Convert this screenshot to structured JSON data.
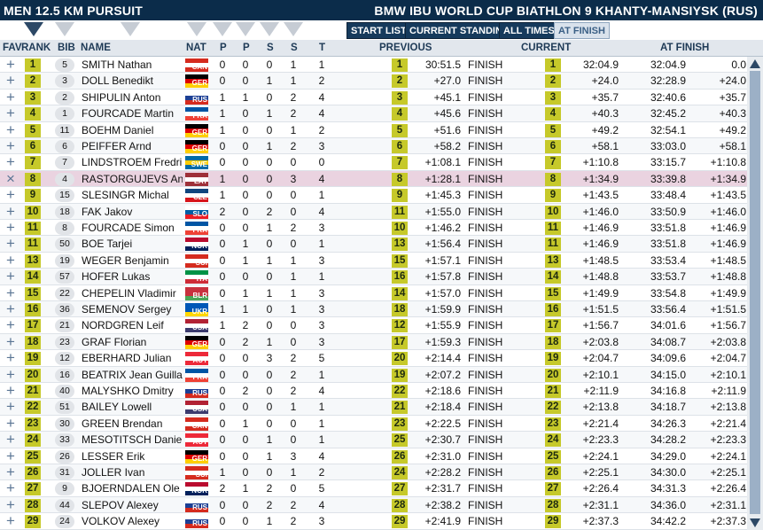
{
  "title_left": "MEN 12.5 KM PURSUIT",
  "title_right": "BMW IBU WORLD CUP BIATHLON 9 KHANTY-MANSIYSK (RUS)",
  "buttons": [
    "START LIST",
    "CURRENT STANDING",
    "ALL TIMES",
    "AT FINISH"
  ],
  "headers": {
    "fav": "FAV",
    "rank": "RANK",
    "bib": "BIB",
    "name": "NAME",
    "nat": "NAT",
    "p1": "P",
    "p2": "P",
    "s1": "S",
    "s2": "S",
    "t": "T",
    "previous": "PREVIOUS",
    "current": "CURRENT",
    "at_finish": "AT FINISH"
  },
  "flag_colors": {
    "CAN": [
      "#d52b1e",
      "#ffffff",
      "#d52b1e"
    ],
    "GER": [
      "#000000",
      "#dd0000",
      "#ffce00"
    ],
    "RUS": [
      "#ffffff",
      "#1c3f94",
      "#d52b1e"
    ],
    "FRA": [
      "#0055a4",
      "#ffffff",
      "#ef4135"
    ],
    "SWE": [
      "#006aa7",
      "#fecc00",
      "#006aa7"
    ],
    "LAT": [
      "#9e3039",
      "#ffffff",
      "#9e3039"
    ],
    "CZE": [
      "#11457e",
      "#ffffff",
      "#d7141a"
    ],
    "SLO": [
      "#ffffff",
      "#005da4",
      "#ed1c24"
    ],
    "NOR": [
      "#ba0c2f",
      "#ffffff",
      "#00205b"
    ],
    "SUI": [
      "#d52b1e",
      "#ffffff",
      "#d52b1e"
    ],
    "ITA": [
      "#009246",
      "#ffffff",
      "#ce2b37"
    ],
    "BLR": [
      "#c8313e",
      "#c8313e",
      "#4aa657"
    ],
    "UKR": [
      "#0057b7",
      "#0057b7",
      "#ffd700"
    ],
    "USA": [
      "#b22234",
      "#ffffff",
      "#3c3b6e"
    ],
    "AUT": [
      "#ed2939",
      "#ffffff",
      "#ed2939"
    ]
  },
  "rows": [
    {
      "rank": "1",
      "bib": "5",
      "name": "SMITH Nathan",
      "nat": "CAN",
      "p1": "0",
      "p2": "0",
      "s1": "0",
      "s2": "1",
      "t": "1",
      "prev_rank": "1",
      "prev_time": "30:51.5",
      "prev_status": "FINISH",
      "cur_rank": "1",
      "cur_diff": "32:04.9",
      "fin_time": "32:04.9",
      "fin_diff": "0.0",
      "fav": false
    },
    {
      "rank": "2",
      "bib": "3",
      "name": "DOLL Benedikt",
      "nat": "GER",
      "p1": "0",
      "p2": "0",
      "s1": "1",
      "s2": "1",
      "t": "2",
      "prev_rank": "2",
      "prev_time": "+27.0",
      "prev_status": "FINISH",
      "cur_rank": "2",
      "cur_diff": "+24.0",
      "fin_time": "32:28.9",
      "fin_diff": "+24.0",
      "fav": false
    },
    {
      "rank": "3",
      "bib": "2",
      "name": "SHIPULIN Anton",
      "nat": "RUS",
      "p1": "1",
      "p2": "1",
      "s1": "0",
      "s2": "2",
      "t": "4",
      "prev_rank": "3",
      "prev_time": "+45.1",
      "prev_status": "FINISH",
      "cur_rank": "3",
      "cur_diff": "+35.7",
      "fin_time": "32:40.6",
      "fin_diff": "+35.7",
      "fav": false
    },
    {
      "rank": "4",
      "bib": "1",
      "name": "FOURCADE Martin",
      "nat": "FRA",
      "p1": "1",
      "p2": "0",
      "s1": "1",
      "s2": "2",
      "t": "4",
      "prev_rank": "4",
      "prev_time": "+45.6",
      "prev_status": "FINISH",
      "cur_rank": "4",
      "cur_diff": "+40.3",
      "fin_time": "32:45.2",
      "fin_diff": "+40.3",
      "fav": false
    },
    {
      "rank": "5",
      "bib": "11",
      "name": "BOEHM Daniel",
      "nat": "GER",
      "p1": "1",
      "p2": "0",
      "s1": "0",
      "s2": "1",
      "t": "2",
      "prev_rank": "5",
      "prev_time": "+51.6",
      "prev_status": "FINISH",
      "cur_rank": "5",
      "cur_diff": "+49.2",
      "fin_time": "32:54.1",
      "fin_diff": "+49.2",
      "fav": false
    },
    {
      "rank": "6",
      "bib": "6",
      "name": "PEIFFER Arnd",
      "nat": "GER",
      "p1": "0",
      "p2": "0",
      "s1": "1",
      "s2": "2",
      "t": "3",
      "prev_rank": "6",
      "prev_time": "+58.2",
      "prev_status": "FINISH",
      "cur_rank": "6",
      "cur_diff": "+58.1",
      "fin_time": "33:03.0",
      "fin_diff": "+58.1",
      "fav": false
    },
    {
      "rank": "7",
      "bib": "7",
      "name": "LINDSTROEM Fredrik",
      "nat": "SWE",
      "p1": "0",
      "p2": "0",
      "s1": "0",
      "s2": "0",
      "t": "0",
      "prev_rank": "7",
      "prev_time": "+1:08.1",
      "prev_status": "FINISH",
      "cur_rank": "7",
      "cur_diff": "+1:10.8",
      "fin_time": "33:15.7",
      "fin_diff": "+1:10.8",
      "fav": false
    },
    {
      "rank": "8",
      "bib": "4",
      "name": "RASTORGUJEVS Andre",
      "nat": "LAT",
      "p1": "1",
      "p2": "0",
      "s1": "0",
      "s2": "3",
      "t": "4",
      "prev_rank": "8",
      "prev_time": "+1:28.1",
      "prev_status": "FINISH",
      "cur_rank": "8",
      "cur_diff": "+1:34.9",
      "fin_time": "33:39.8",
      "fin_diff": "+1:34.9",
      "fav": true
    },
    {
      "rank": "9",
      "bib": "15",
      "name": "SLESINGR Michal",
      "nat": "CZE",
      "p1": "1",
      "p2": "0",
      "s1": "0",
      "s2": "0",
      "t": "1",
      "prev_rank": "9",
      "prev_time": "+1:45.3",
      "prev_status": "FINISH",
      "cur_rank": "9",
      "cur_diff": "+1:43.5",
      "fin_time": "33:48.4",
      "fin_diff": "+1:43.5",
      "fav": false
    },
    {
      "rank": "10",
      "bib": "18",
      "name": "FAK Jakov",
      "nat": "SLO",
      "p1": "2",
      "p2": "0",
      "s1": "2",
      "s2": "0",
      "t": "4",
      "prev_rank": "11",
      "prev_time": "+1:55.0",
      "prev_status": "FINISH",
      "cur_rank": "10",
      "cur_diff": "+1:46.0",
      "fin_time": "33:50.9",
      "fin_diff": "+1:46.0",
      "fav": false
    },
    {
      "rank": "11",
      "bib": "8",
      "name": "FOURCADE Simon",
      "nat": "FRA",
      "p1": "0",
      "p2": "0",
      "s1": "1",
      "s2": "2",
      "t": "3",
      "prev_rank": "10",
      "prev_time": "+1:46.2",
      "prev_status": "FINISH",
      "cur_rank": "11",
      "cur_diff": "+1:46.9",
      "fin_time": "33:51.8",
      "fin_diff": "+1:46.9",
      "fav": false
    },
    {
      "rank": "11",
      "bib": "50",
      "name": "BOE Tarjei",
      "nat": "NOR",
      "p1": "0",
      "p2": "1",
      "s1": "0",
      "s2": "0",
      "t": "1",
      "prev_rank": "13",
      "prev_time": "+1:56.4",
      "prev_status": "FINISH",
      "cur_rank": "11",
      "cur_diff": "+1:46.9",
      "fin_time": "33:51.8",
      "fin_diff": "+1:46.9",
      "fav": false
    },
    {
      "rank": "13",
      "bib": "19",
      "name": "WEGER Benjamin",
      "nat": "SUI",
      "p1": "0",
      "p2": "1",
      "s1": "1",
      "s2": "1",
      "t": "3",
      "prev_rank": "15",
      "prev_time": "+1:57.1",
      "prev_status": "FINISH",
      "cur_rank": "13",
      "cur_diff": "+1:48.5",
      "fin_time": "33:53.4",
      "fin_diff": "+1:48.5",
      "fav": false
    },
    {
      "rank": "14",
      "bib": "57",
      "name": "HOFER Lukas",
      "nat": "ITA",
      "p1": "0",
      "p2": "0",
      "s1": "0",
      "s2": "1",
      "t": "1",
      "prev_rank": "16",
      "prev_time": "+1:57.8",
      "prev_status": "FINISH",
      "cur_rank": "14",
      "cur_diff": "+1:48.8",
      "fin_time": "33:53.7",
      "fin_diff": "+1:48.8",
      "fav": false
    },
    {
      "rank": "15",
      "bib": "22",
      "name": "CHEPELIN Vladimir",
      "nat": "BLR",
      "p1": "0",
      "p2": "1",
      "s1": "1",
      "s2": "1",
      "t": "3",
      "prev_rank": "14",
      "prev_time": "+1:57.0",
      "prev_status": "FINISH",
      "cur_rank": "15",
      "cur_diff": "+1:49.9",
      "fin_time": "33:54.8",
      "fin_diff": "+1:49.9",
      "fav": false
    },
    {
      "rank": "16",
      "bib": "36",
      "name": "SEMENOV Sergey",
      "nat": "UKR",
      "p1": "1",
      "p2": "1",
      "s1": "0",
      "s2": "1",
      "t": "3",
      "prev_rank": "18",
      "prev_time": "+1:59.9",
      "prev_status": "FINISH",
      "cur_rank": "16",
      "cur_diff": "+1:51.5",
      "fin_time": "33:56.4",
      "fin_diff": "+1:51.5",
      "fav": false
    },
    {
      "rank": "17",
      "bib": "21",
      "name": "NORDGREN Leif",
      "nat": "USA",
      "p1": "1",
      "p2": "2",
      "s1": "0",
      "s2": "0",
      "t": "3",
      "prev_rank": "12",
      "prev_time": "+1:55.9",
      "prev_status": "FINISH",
      "cur_rank": "17",
      "cur_diff": "+1:56.7",
      "fin_time": "34:01.6",
      "fin_diff": "+1:56.7",
      "fav": false
    },
    {
      "rank": "18",
      "bib": "23",
      "name": "GRAF Florian",
      "nat": "GER",
      "p1": "0",
      "p2": "2",
      "s1": "1",
      "s2": "0",
      "t": "3",
      "prev_rank": "17",
      "prev_time": "+1:59.3",
      "prev_status": "FINISH",
      "cur_rank": "18",
      "cur_diff": "+2:03.8",
      "fin_time": "34:08.7",
      "fin_diff": "+2:03.8",
      "fav": false
    },
    {
      "rank": "19",
      "bib": "12",
      "name": "EBERHARD Julian",
      "nat": "AUT",
      "p1": "0",
      "p2": "0",
      "s1": "3",
      "s2": "2",
      "t": "5",
      "prev_rank": "20",
      "prev_time": "+2:14.4",
      "prev_status": "FINISH",
      "cur_rank": "19",
      "cur_diff": "+2:04.7",
      "fin_time": "34:09.6",
      "fin_diff": "+2:04.7",
      "fav": false
    },
    {
      "rank": "20",
      "bib": "16",
      "name": "BEATRIX Jean Guillau",
      "nat": "FRA",
      "p1": "0",
      "p2": "0",
      "s1": "0",
      "s2": "2",
      "t": "1",
      "prev_rank": "19",
      "prev_time": "+2:07.2",
      "prev_status": "FINISH",
      "cur_rank": "20",
      "cur_diff": "+2:10.1",
      "fin_time": "34:15.0",
      "fin_diff": "+2:10.1",
      "fav": false
    },
    {
      "rank": "21",
      "bib": "40",
      "name": "MALYSHKO Dmitry",
      "nat": "RUS",
      "p1": "0",
      "p2": "2",
      "s1": "0",
      "s2": "2",
      "t": "4",
      "prev_rank": "22",
      "prev_time": "+2:18.6",
      "prev_status": "FINISH",
      "cur_rank": "21",
      "cur_diff": "+2:11.9",
      "fin_time": "34:16.8",
      "fin_diff": "+2:11.9",
      "fav": false
    },
    {
      "rank": "22",
      "bib": "51",
      "name": "BAILEY Lowell",
      "nat": "USA",
      "p1": "0",
      "p2": "0",
      "s1": "0",
      "s2": "1",
      "t": "1",
      "prev_rank": "21",
      "prev_time": "+2:18.4",
      "prev_status": "FINISH",
      "cur_rank": "22",
      "cur_diff": "+2:13.8",
      "fin_time": "34:18.7",
      "fin_diff": "+2:13.8",
      "fav": false
    },
    {
      "rank": "23",
      "bib": "30",
      "name": "GREEN Brendan",
      "nat": "CAN",
      "p1": "0",
      "p2": "1",
      "s1": "0",
      "s2": "0",
      "t": "1",
      "prev_rank": "23",
      "prev_time": "+2:22.5",
      "prev_status": "FINISH",
      "cur_rank": "23",
      "cur_diff": "+2:21.4",
      "fin_time": "34:26.3",
      "fin_diff": "+2:21.4",
      "fav": false
    },
    {
      "rank": "24",
      "bib": "33",
      "name": "MESOTITSCH Daniel",
      "nat": "AUT",
      "p1": "0",
      "p2": "0",
      "s1": "1",
      "s2": "0",
      "t": "1",
      "prev_rank": "25",
      "prev_time": "+2:30.7",
      "prev_status": "FINISH",
      "cur_rank": "24",
      "cur_diff": "+2:23.3",
      "fin_time": "34:28.2",
      "fin_diff": "+2:23.3",
      "fav": false
    },
    {
      "rank": "25",
      "bib": "26",
      "name": "LESSER Erik",
      "nat": "GER",
      "p1": "0",
      "p2": "0",
      "s1": "1",
      "s2": "3",
      "t": "4",
      "prev_rank": "26",
      "prev_time": "+2:31.0",
      "prev_status": "FINISH",
      "cur_rank": "25",
      "cur_diff": "+2:24.1",
      "fin_time": "34:29.0",
      "fin_diff": "+2:24.1",
      "fav": false
    },
    {
      "rank": "26",
      "bib": "31",
      "name": "JOLLER Ivan",
      "nat": "SUI",
      "p1": "1",
      "p2": "0",
      "s1": "0",
      "s2": "1",
      "t": "2",
      "prev_rank": "24",
      "prev_time": "+2:28.2",
      "prev_status": "FINISH",
      "cur_rank": "26",
      "cur_diff": "+2:25.1",
      "fin_time": "34:30.0",
      "fin_diff": "+2:25.1",
      "fav": false
    },
    {
      "rank": "27",
      "bib": "9",
      "name": "BJOERNDALEN Ole Ein",
      "nat": "NOR",
      "p1": "2",
      "p2": "1",
      "s1": "2",
      "s2": "0",
      "t": "5",
      "prev_rank": "27",
      "prev_time": "+2:31.7",
      "prev_status": "FINISH",
      "cur_rank": "27",
      "cur_diff": "+2:26.4",
      "fin_time": "34:31.3",
      "fin_diff": "+2:26.4",
      "fav": false
    },
    {
      "rank": "28",
      "bib": "44",
      "name": "SLEPOV Alexey",
      "nat": "RUS",
      "p1": "0",
      "p2": "0",
      "s1": "2",
      "s2": "2",
      "t": "4",
      "prev_rank": "28",
      "prev_time": "+2:38.2",
      "prev_status": "FINISH",
      "cur_rank": "28",
      "cur_diff": "+2:31.1",
      "fin_time": "34:36.0",
      "fin_diff": "+2:31.1",
      "fav": false
    },
    {
      "rank": "29",
      "bib": "24",
      "name": "VOLKOV Alexey",
      "nat": "RUS",
      "p1": "0",
      "p2": "0",
      "s1": "1",
      "s2": "2",
      "t": "3",
      "prev_rank": "29",
      "prev_time": "+2:41.9",
      "prev_status": "FINISH",
      "cur_rank": "29",
      "cur_diff": "+2:37.3",
      "fin_time": "34:42.2",
      "fin_diff": "+2:37.3",
      "fav": false
    }
  ]
}
